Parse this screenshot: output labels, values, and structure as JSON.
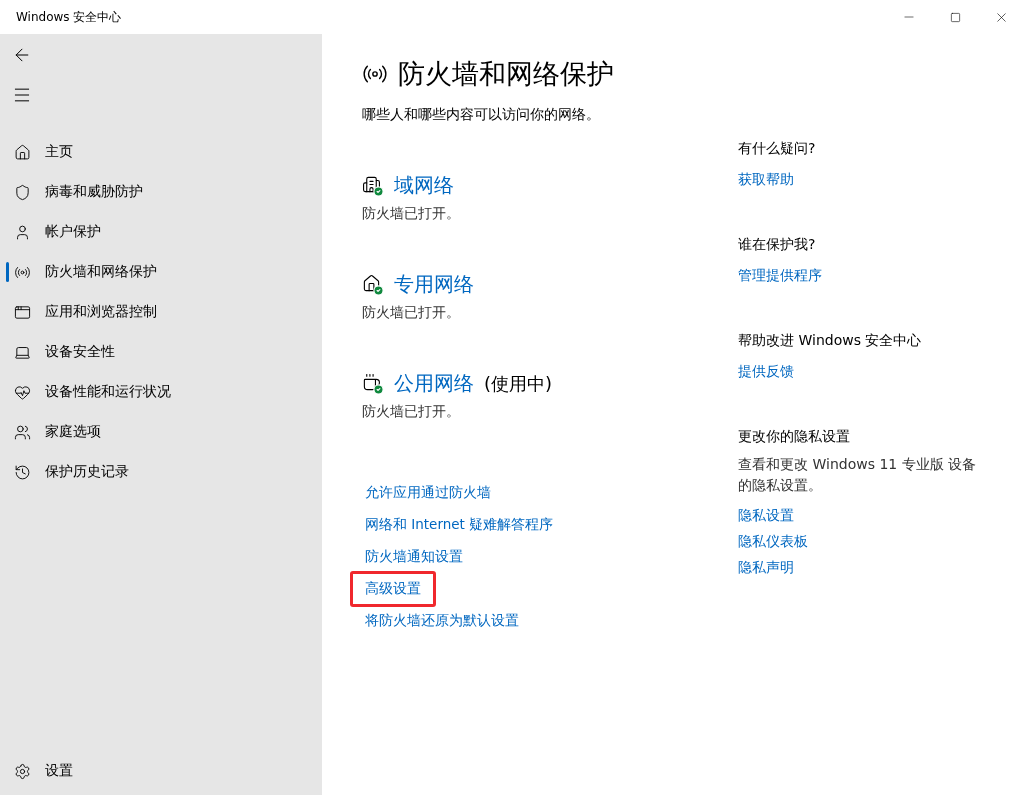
{
  "window": {
    "title": "Windows 安全中心"
  },
  "sidebar": {
    "items": [
      {
        "label": "主页",
        "selected": false
      },
      {
        "label": "病毒和威胁防护",
        "selected": false
      },
      {
        "label": "帐户保护",
        "selected": false
      },
      {
        "label": "防火墙和网络保护",
        "selected": true
      },
      {
        "label": "应用和浏览器控制",
        "selected": false
      },
      {
        "label": "设备安全性",
        "selected": false
      },
      {
        "label": "设备性能和运行状况",
        "selected": false
      },
      {
        "label": "家庭选项",
        "selected": false
      },
      {
        "label": "保护历史记录",
        "selected": false
      }
    ],
    "settings": "设置"
  },
  "page": {
    "title": "防火墙和网络保护",
    "subtitle": "哪些人和哪些内容可以访问你的网络。",
    "networks": [
      {
        "name": "域网络",
        "status": "防火墙已打开。"
      },
      {
        "name": "专用网络",
        "status": "防火墙已打开。"
      },
      {
        "name": "公用网络",
        "in_use_label": "(使用中)",
        "status": "防火墙已打开。"
      }
    ],
    "links": [
      {
        "label": "允许应用通过防火墙",
        "highlighted": false
      },
      {
        "label": "网络和 Internet 疑难解答程序",
        "highlighted": false
      },
      {
        "label": "防火墙通知设置",
        "highlighted": false
      },
      {
        "label": "高级设置",
        "highlighted": true
      },
      {
        "label": "将防火墙还原为默认设置",
        "highlighted": false
      }
    ]
  },
  "aside": [
    {
      "heading": "有什么疑问?",
      "links": [
        "获取帮助"
      ]
    },
    {
      "heading": "谁在保护我?",
      "links": [
        "管理提供程序"
      ]
    },
    {
      "heading": "帮助改进 Windows 安全中心",
      "links": [
        "提供反馈"
      ]
    },
    {
      "heading": "更改你的隐私设置",
      "text": "查看和更改 Windows 11 专业版 设备的隐私设置。",
      "links": [
        "隐私设置",
        "隐私仪表板",
        "隐私声明"
      ]
    }
  ]
}
